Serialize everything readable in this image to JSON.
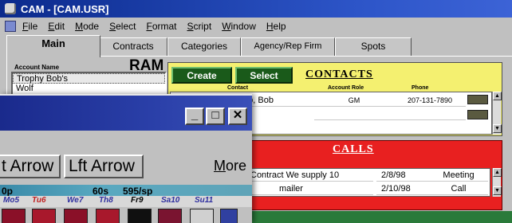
{
  "window": {
    "title": "CAM - [CAM.USR]"
  },
  "menu": [
    "File",
    "Edit",
    "Mode",
    "Select",
    "Format",
    "Script",
    "Window",
    "Help"
  ],
  "tabs": [
    "Main",
    "Contracts",
    "Categories",
    "Agency/Rep Firm",
    "Spots"
  ],
  "account": {
    "label": "Account Name",
    "heading": "RAM",
    "rows": [
      "Trophy Bob's",
      "Wolf"
    ]
  },
  "contacts": {
    "buttons": {
      "create": "Create",
      "select": "Select"
    },
    "title": "CONTACTS",
    "columns": [
      "Contact",
      "Account Role",
      "Phone"
    ],
    "rows": [
      {
        "name": "...o, Bob",
        "role": "GM",
        "phone": "207-131-7890"
      }
    ]
  },
  "calls": {
    "title": "CALLS",
    "rows": [
      {
        "note": "Contract We supply 10",
        "date": "2/8/98",
        "action": "Meeting"
      },
      {
        "note": "mailer",
        "date": "2/10/98",
        "action": "Call"
      }
    ]
  },
  "front_window": {
    "controls": {
      "minimize": "_",
      "maximize": "□",
      "close": "✕"
    },
    "buttons": {
      "right_arrow": "t Arrow",
      "left_arrow": "Lft Arrow",
      "more": "More"
    },
    "calendar": {
      "left": "0p",
      "mid": "60s",
      "right": "595/sp"
    },
    "days": [
      "Mo5",
      "Tu6",
      "We7",
      "Th8",
      "Fr9",
      "Sa10",
      "Su11"
    ]
  },
  "colors": {
    "contacts_bg": "#f4f070",
    "calls_bg": "#e82020",
    "title_blue": "#0b2a8c"
  }
}
